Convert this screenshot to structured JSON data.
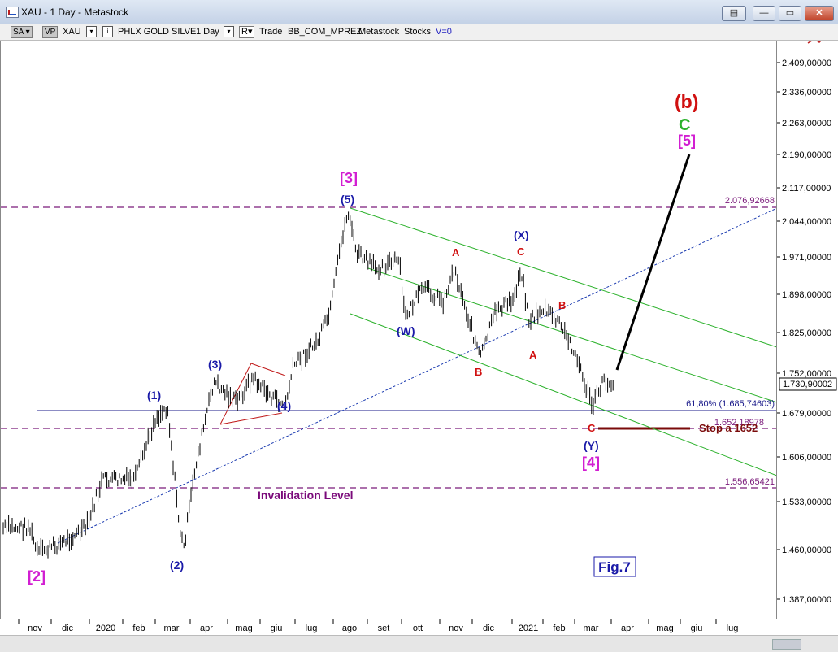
{
  "window": {
    "title": "XAU - 1 Day - Metastock"
  },
  "toolbar": {
    "sa": "SA",
    "vp": "VP",
    "symbol": "XAU",
    "symbol_name": "PHLX GOLD SILVE",
    "period": "1 Day",
    "r_label": "R",
    "mode": "Trade",
    "indicator": "BB_COM_MPREZ",
    "source": "Metastock",
    "type": "Stocks",
    "volume": "V=0"
  },
  "axis": {
    "y_ticks": [
      "2.409,00000",
      "2.336,00000",
      "2.263,00000",
      "2.190,00000",
      "2.117,00000",
      "2.044,00000",
      "1.971,00000",
      "1.898,00000",
      "1.825,00000",
      "1.752,00000",
      "1.679,00000",
      "1.606,00000",
      "1.533,00000",
      "1.460,00000",
      "1.387,00000"
    ],
    "last_price": "1.730,90002",
    "x_ticks": [
      "nov",
      "dic",
      "2020",
      "feb",
      "mar",
      "apr",
      "mag",
      "giu",
      "lug",
      "ago",
      "set",
      "ott",
      "nov",
      "dic",
      "2021",
      "feb",
      "mar",
      "apr",
      "mag",
      "giu",
      "lug"
    ]
  },
  "levels": {
    "top": "2.076,92668",
    "fib": "61,80% (1.685,74603)",
    "mid": "1.652,18978",
    "low": "1.556,65421"
  },
  "labels": {
    "stop": "Stop a 1652",
    "invalidation": "Invalidation Level",
    "fig": "Fig.7",
    "w2": "[2]",
    "w3": "[3]",
    "w4": "[4]",
    "w5": "[5]",
    "p1": "(1)",
    "p2": "(2)",
    "p3": "(3)",
    "p4": "(4)",
    "p5": "(5)",
    "W": "(W)",
    "X": "(X)",
    "Y": "(Y)",
    "b": "(b)",
    "C_green": "C",
    "A": "A",
    "B": "B",
    "C": "C"
  },
  "colors": {
    "blue": "#1a1aa8",
    "magenta": "#d21ed2",
    "red": "#d01010",
    "green": "#2bb12b",
    "purple": "#7a0a7a",
    "dashed": "#7a1a7a"
  }
}
